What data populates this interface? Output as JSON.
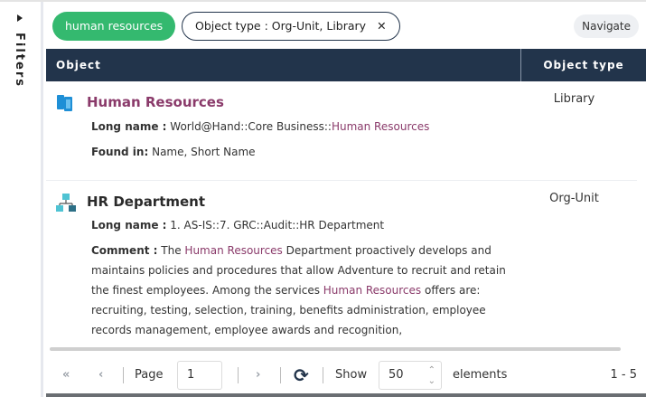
{
  "sidebar": {
    "label": "Filters"
  },
  "chips": {
    "search": "human resources",
    "filter": "Object type : Org-Unit, Library",
    "remove": "✕"
  },
  "navigate": "Navigate",
  "table": {
    "col_object": "Object",
    "col_type": "Object type"
  },
  "rows": [
    {
      "title": "Human Resources",
      "type": "Library",
      "icon": "library-icon",
      "long_label": "Long name :",
      "long_pre": "World@Hand::Core Business::",
      "long_hl": "Human Resources",
      "found_label": "Found in:",
      "found": "Name, Short Name"
    },
    {
      "title": "HR Department",
      "type": "Org-Unit",
      "icon": "org-unit-icon",
      "long_label": "Long name :",
      "long": "1. AS-IS::7. GRC::Audit::HR Department",
      "comment_label": "Comment :",
      "c1": "The ",
      "c2": "Human Resources",
      "c3": " Department proactively develops and maintains policies and procedures that allow Adventure to recruit and retain the finest employees. Among the services ",
      "c4": "Human Resources",
      "c5": " offers are: recruiting, testing, selection, training, benefits administration, employee records management, employee awards and recognition,"
    }
  ],
  "pager": {
    "page_label": "Page",
    "page": "1",
    "show_label": "Show",
    "show": "50",
    "elements_label": "elements",
    "range": "1 - 5"
  }
}
